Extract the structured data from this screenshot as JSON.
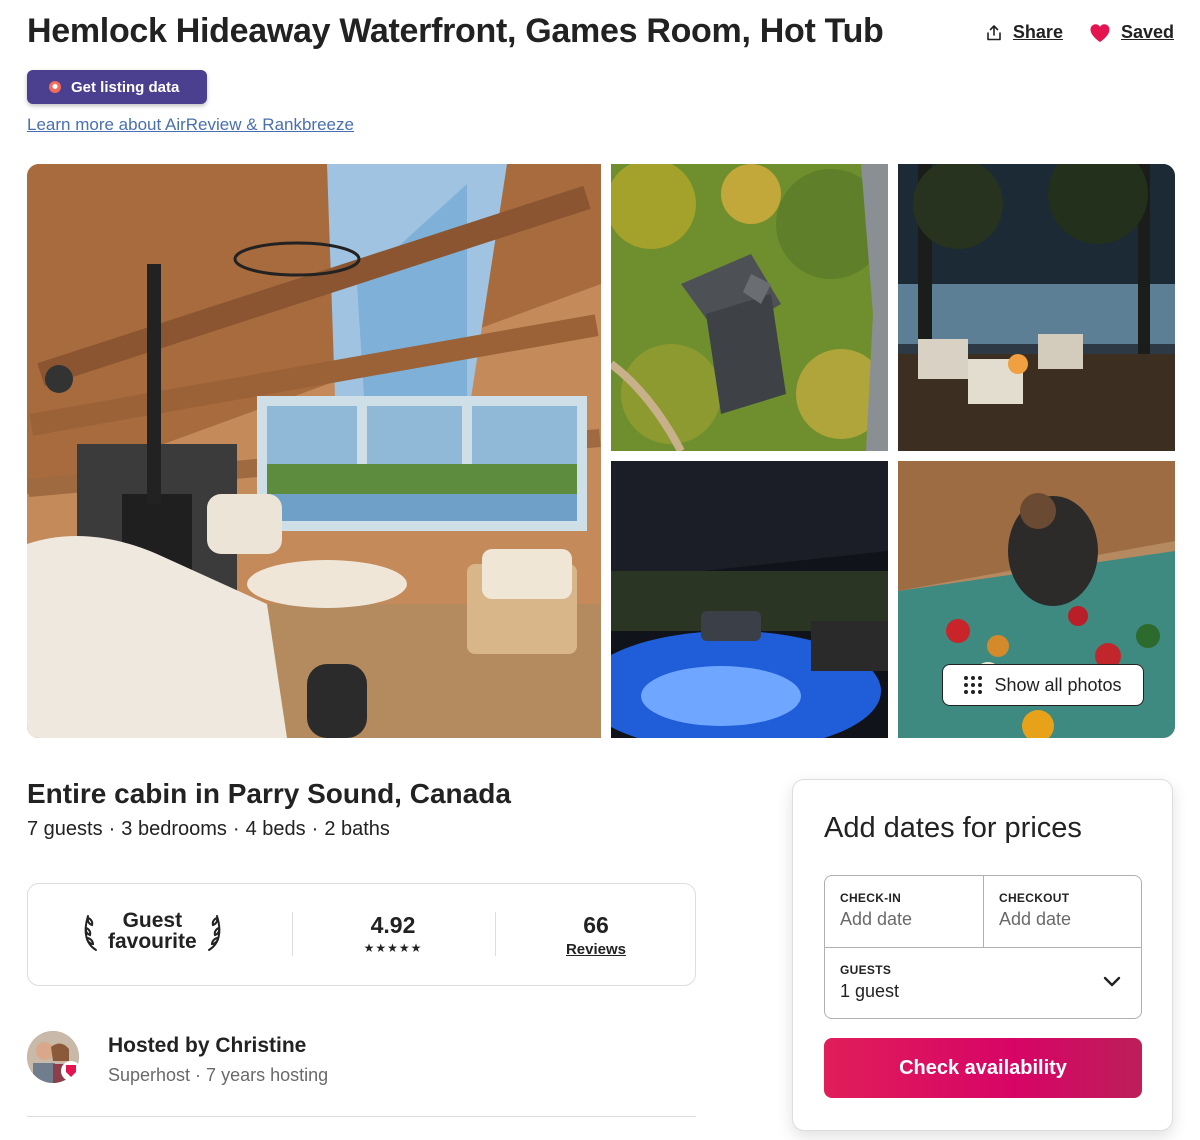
{
  "header": {
    "title": "Hemlock Hideaway Waterfront, Games Room, Hot Tub",
    "share_label": "Share",
    "saved_label": "Saved",
    "share_icon": "share-icon",
    "saved_icon": "heart-icon"
  },
  "extension": {
    "button_label": "Get listing data",
    "learn_link": "Learn more about AirReview & Rankbreeze",
    "button_color": "#4b3f8f"
  },
  "gallery": {
    "photos": [
      "living-room",
      "aerial-view",
      "lakeside-deck",
      "hot-tub",
      "games-room"
    ],
    "show_all_label": "Show all photos"
  },
  "listing": {
    "subtitle": "Entire cabin in Parry Sound, Canada",
    "facts": [
      "7 guests",
      "3 bedrooms",
      "4 beds",
      "2 baths"
    ],
    "fact_separator": "·"
  },
  "highlights": {
    "badge_line1": "Guest",
    "badge_line2": "favourite",
    "rating": "4.92",
    "stars": "★★★★★",
    "review_count": "66",
    "reviews_label": "Reviews"
  },
  "host": {
    "name_line": "Hosted by Christine",
    "details": "Superhost · 7 years hosting",
    "badge_color": "#e3144f"
  },
  "booking": {
    "title": "Add dates for prices",
    "checkin_label": "CHECK-IN",
    "checkin_value": "Add date",
    "checkout_label": "CHECKOUT",
    "checkout_value": "Add date",
    "guests_label": "GUESTS",
    "guests_value": "1 guest",
    "cta_label": "Check availability",
    "cta_color": "#e01e5a"
  }
}
